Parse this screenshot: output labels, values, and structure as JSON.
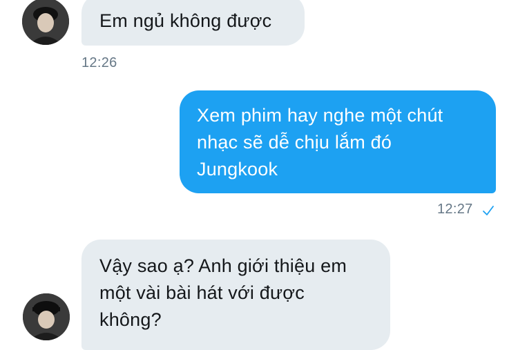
{
  "conversation": {
    "messages": [
      {
        "direction": "incoming",
        "text": "Em ngủ không được",
        "time": "12:26"
      },
      {
        "direction": "outgoing",
        "line1": "Xem phim hay nghe một chút",
        "line2": "nhạc sẽ dễ chịu lắm đó",
        "line3": "Jungkook",
        "time": "12:27",
        "status_icon": "checkmark-icon"
      },
      {
        "direction": "incoming",
        "line1": "Vậy sao ạ? Anh giới thiệu em",
        "line2": "một vài bài hát với được",
        "line3": "không?"
      }
    ]
  },
  "colors": {
    "incoming_bubble": "#e6ecf0",
    "outgoing_bubble": "#1da1f2",
    "timestamp": "#657786",
    "read_check": "#1da1f2"
  }
}
